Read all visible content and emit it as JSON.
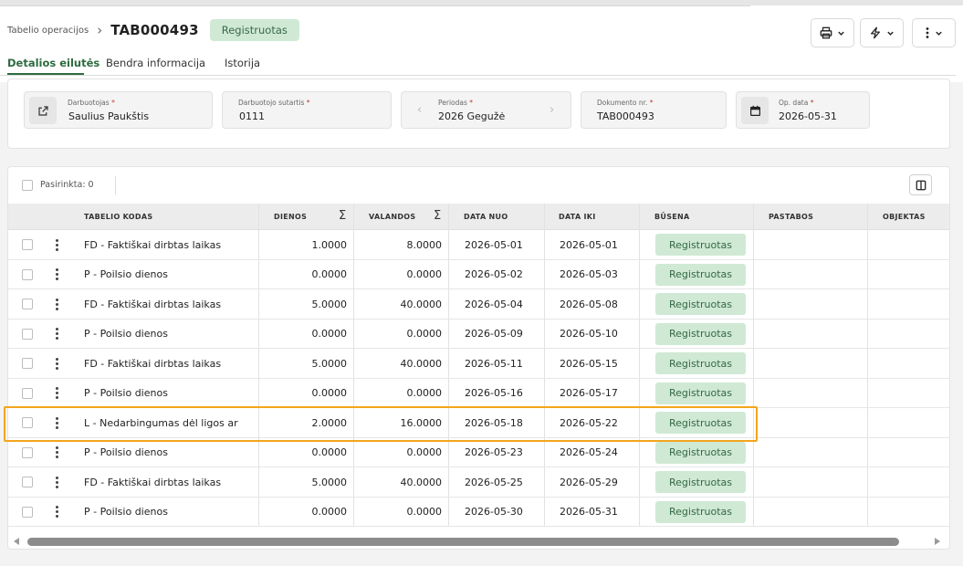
{
  "breadcrumb": {
    "parent": "Tabelio operacijos",
    "separator": "›",
    "current": "TAB000493"
  },
  "status": {
    "label": "Registruotas",
    "bg": "#cfe9d5",
    "fg": "#3a6b47"
  },
  "toolbar": {
    "print_icon": "printer-icon",
    "actions_icon": "lightning-icon",
    "more_icon": "vertical-dots-icon"
  },
  "tabs": [
    {
      "label": "Detalios eilutės",
      "active": true
    },
    {
      "label": "Bendra informacija",
      "active": false
    },
    {
      "label": "Istorija",
      "active": false
    }
  ],
  "fields": {
    "employee": {
      "label": "Darbuotojas",
      "value": "Saulius Paukštis",
      "required": "*"
    },
    "contract": {
      "label": "Darbuotojo sutartis",
      "value": "0111",
      "required": "*"
    },
    "period": {
      "label": "Periodas",
      "value": "2026 Gegužė",
      "required": "*"
    },
    "document": {
      "label": "Dokumento nr.",
      "value": "TAB000493",
      "required": "*"
    },
    "op_date": {
      "label": "Op. data",
      "value": "2026-05-31",
      "required": "*"
    }
  },
  "grid": {
    "selected_text": "Pasirinkta: 0",
    "sigma": "Σ",
    "columns": {
      "code": "TABELIO KODAS",
      "days": "DIENOS",
      "hours": "VALANDOS",
      "from": "DATA NUO",
      "to": "DATA IKI",
      "status": "BŪSENA",
      "notes": "PASTABOS",
      "object": "OBJEKTAS"
    },
    "rows": [
      {
        "code": "FD - Faktiškai dirbtas laikas",
        "days": "1.0000",
        "hours": "8.0000",
        "from": "2026-05-01",
        "to": "2026-05-01",
        "status": "Registruotas"
      },
      {
        "code": "P - Poilsio dienos",
        "days": "0.0000",
        "hours": "0.0000",
        "from": "2026-05-02",
        "to": "2026-05-03",
        "status": "Registruotas"
      },
      {
        "code": "FD - Faktiškai dirbtas laikas",
        "days": "5.0000",
        "hours": "40.0000",
        "from": "2026-05-04",
        "to": "2026-05-08",
        "status": "Registruotas"
      },
      {
        "code": "P - Poilsio dienos",
        "days": "0.0000",
        "hours": "0.0000",
        "from": "2026-05-09",
        "to": "2026-05-10",
        "status": "Registruotas"
      },
      {
        "code": "FD - Faktiškai dirbtas laikas",
        "days": "5.0000",
        "hours": "40.0000",
        "from": "2026-05-11",
        "to": "2026-05-15",
        "status": "Registruotas"
      },
      {
        "code": "P - Poilsio dienos",
        "days": "0.0000",
        "hours": "0.0000",
        "from": "2026-05-16",
        "to": "2026-05-17",
        "status": "Registruotas"
      },
      {
        "code": "L - Nedarbingumas dėl ligos ar",
        "days": "2.0000",
        "hours": "16.0000",
        "from": "2026-05-18",
        "to": "2026-05-22",
        "status": "Registruotas"
      },
      {
        "code": "P - Poilsio dienos",
        "days": "0.0000",
        "hours": "0.0000",
        "from": "2026-05-23",
        "to": "2026-05-24",
        "status": "Registruotas"
      },
      {
        "code": "FD - Faktiškai dirbtas laikas",
        "days": "5.0000",
        "hours": "40.0000",
        "from": "2026-05-25",
        "to": "2026-05-29",
        "status": "Registruotas"
      },
      {
        "code": "P - Poilsio dienos",
        "days": "0.0000",
        "hours": "0.0000",
        "from": "2026-05-30",
        "to": "2026-05-31",
        "status": "Registruotas"
      }
    ]
  },
  "colors": {
    "accent": "#2e6b40",
    "highlight": "#f3a51d",
    "badge_bg": "#cfe9d5"
  }
}
